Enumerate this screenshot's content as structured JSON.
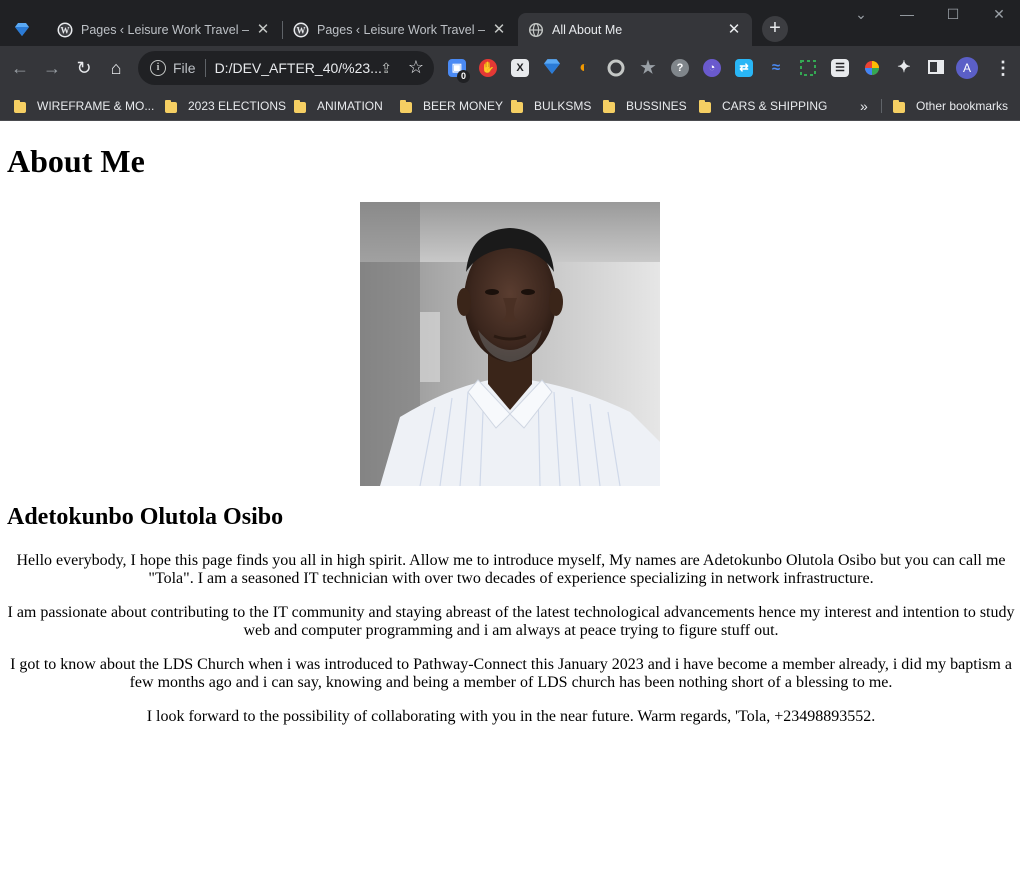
{
  "browser": {
    "tabs": [
      {
        "title": "",
        "favicon": "sketch-diamond-icon",
        "pinned": true
      },
      {
        "title": "Pages ‹ Leisure Work Travel — W",
        "favicon": "wordpress-icon"
      },
      {
        "title": "Pages ‹ Leisure Work Travel — W",
        "favicon": "wordpress-icon"
      },
      {
        "title": "All About Me",
        "favicon": "globe-icon",
        "active": true
      }
    ],
    "address": {
      "scheme_label": "File",
      "url": "D:/DEV_AFTER_40/%23..."
    },
    "extension_badge": "0",
    "profile_initial": "A",
    "bookmarks": [
      "WIREFRAME & MO...",
      "2023 ELECTIONS",
      "ANIMATION",
      "BEER MONEY",
      "BULKSMS",
      "BUSSINES",
      "CARS & SHIPPING"
    ],
    "more_bookmarks": "»",
    "other_bookmarks": "Other bookmarks"
  },
  "page": {
    "heading": "About Me",
    "photo": "portrait-photo",
    "name": "Adetokunbo Olutola Osibo",
    "paragraphs": [
      "Hello everybody, I hope this page finds you all in high spirit. Allow me to introduce myself, My names are Adetokunbo Olutola Osibo but you can call me \"Tola\". I am a seasoned IT technician with over two decades of experience specializing in network infrastructure.",
      "I am passionate about contributing to the IT community and staying abreast of the latest technological advancements hence my interest and intention to study web and computer programming and i am always at peace trying to figure stuff out.",
      "I got to know about the LDS Church when i was introduced to Pathway-Connect this January 2023 and i have become a member already, i did my baptism a few months ago and i can say, knowing and being a member of LDS church has been nothing short of a blessing to me.",
      "I look forward to the possibility of collaborating with you in the near future. Warm regards, 'Tola, +23498893552."
    ]
  },
  "colors": {
    "chrome_dark": "#202124",
    "chrome_toolbar": "#35363a",
    "bookmark_folder": "#f5cf63"
  }
}
